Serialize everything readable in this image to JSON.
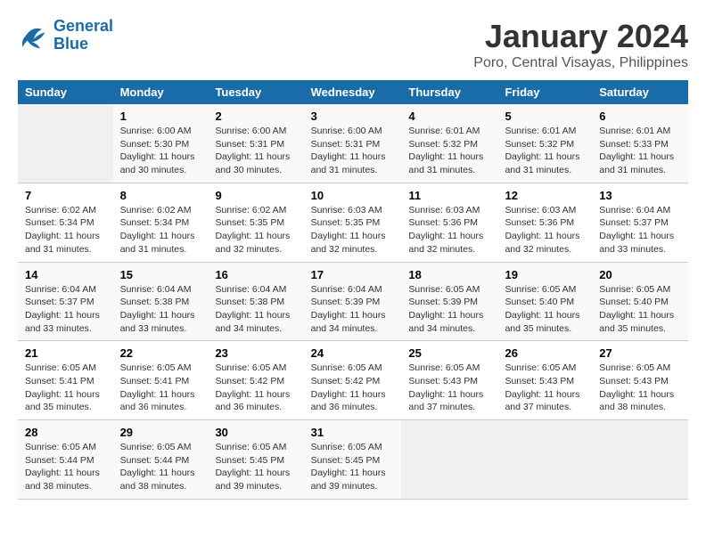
{
  "logo": {
    "line1": "General",
    "line2": "Blue"
  },
  "title": "January 2024",
  "location": "Poro, Central Visayas, Philippines",
  "weekdays": [
    "Sunday",
    "Monday",
    "Tuesday",
    "Wednesday",
    "Thursday",
    "Friday",
    "Saturday"
  ],
  "rows": [
    [
      {
        "day": "",
        "info": ""
      },
      {
        "day": "1",
        "info": "Sunrise: 6:00 AM\nSunset: 5:30 PM\nDaylight: 11 hours\nand 30 minutes."
      },
      {
        "day": "2",
        "info": "Sunrise: 6:00 AM\nSunset: 5:31 PM\nDaylight: 11 hours\nand 30 minutes."
      },
      {
        "day": "3",
        "info": "Sunrise: 6:00 AM\nSunset: 5:31 PM\nDaylight: 11 hours\nand 31 minutes."
      },
      {
        "day": "4",
        "info": "Sunrise: 6:01 AM\nSunset: 5:32 PM\nDaylight: 11 hours\nand 31 minutes."
      },
      {
        "day": "5",
        "info": "Sunrise: 6:01 AM\nSunset: 5:32 PM\nDaylight: 11 hours\nand 31 minutes."
      },
      {
        "day": "6",
        "info": "Sunrise: 6:01 AM\nSunset: 5:33 PM\nDaylight: 11 hours\nand 31 minutes."
      }
    ],
    [
      {
        "day": "7",
        "info": "Sunrise: 6:02 AM\nSunset: 5:34 PM\nDaylight: 11 hours\nand 31 minutes."
      },
      {
        "day": "8",
        "info": "Sunrise: 6:02 AM\nSunset: 5:34 PM\nDaylight: 11 hours\nand 31 minutes."
      },
      {
        "day": "9",
        "info": "Sunrise: 6:02 AM\nSunset: 5:35 PM\nDaylight: 11 hours\nand 32 minutes."
      },
      {
        "day": "10",
        "info": "Sunrise: 6:03 AM\nSunset: 5:35 PM\nDaylight: 11 hours\nand 32 minutes."
      },
      {
        "day": "11",
        "info": "Sunrise: 6:03 AM\nSunset: 5:36 PM\nDaylight: 11 hours\nand 32 minutes."
      },
      {
        "day": "12",
        "info": "Sunrise: 6:03 AM\nSunset: 5:36 PM\nDaylight: 11 hours\nand 32 minutes."
      },
      {
        "day": "13",
        "info": "Sunrise: 6:04 AM\nSunset: 5:37 PM\nDaylight: 11 hours\nand 33 minutes."
      }
    ],
    [
      {
        "day": "14",
        "info": "Sunrise: 6:04 AM\nSunset: 5:37 PM\nDaylight: 11 hours\nand 33 minutes."
      },
      {
        "day": "15",
        "info": "Sunrise: 6:04 AM\nSunset: 5:38 PM\nDaylight: 11 hours\nand 33 minutes."
      },
      {
        "day": "16",
        "info": "Sunrise: 6:04 AM\nSunset: 5:38 PM\nDaylight: 11 hours\nand 34 minutes."
      },
      {
        "day": "17",
        "info": "Sunrise: 6:04 AM\nSunset: 5:39 PM\nDaylight: 11 hours\nand 34 minutes."
      },
      {
        "day": "18",
        "info": "Sunrise: 6:05 AM\nSunset: 5:39 PM\nDaylight: 11 hours\nand 34 minutes."
      },
      {
        "day": "19",
        "info": "Sunrise: 6:05 AM\nSunset: 5:40 PM\nDaylight: 11 hours\nand 35 minutes."
      },
      {
        "day": "20",
        "info": "Sunrise: 6:05 AM\nSunset: 5:40 PM\nDaylight: 11 hours\nand 35 minutes."
      }
    ],
    [
      {
        "day": "21",
        "info": "Sunrise: 6:05 AM\nSunset: 5:41 PM\nDaylight: 11 hours\nand 35 minutes."
      },
      {
        "day": "22",
        "info": "Sunrise: 6:05 AM\nSunset: 5:41 PM\nDaylight: 11 hours\nand 36 minutes."
      },
      {
        "day": "23",
        "info": "Sunrise: 6:05 AM\nSunset: 5:42 PM\nDaylight: 11 hours\nand 36 minutes."
      },
      {
        "day": "24",
        "info": "Sunrise: 6:05 AM\nSunset: 5:42 PM\nDaylight: 11 hours\nand 36 minutes."
      },
      {
        "day": "25",
        "info": "Sunrise: 6:05 AM\nSunset: 5:43 PM\nDaylight: 11 hours\nand 37 minutes."
      },
      {
        "day": "26",
        "info": "Sunrise: 6:05 AM\nSunset: 5:43 PM\nDaylight: 11 hours\nand 37 minutes."
      },
      {
        "day": "27",
        "info": "Sunrise: 6:05 AM\nSunset: 5:43 PM\nDaylight: 11 hours\nand 38 minutes."
      }
    ],
    [
      {
        "day": "28",
        "info": "Sunrise: 6:05 AM\nSunset: 5:44 PM\nDaylight: 11 hours\nand 38 minutes."
      },
      {
        "day": "29",
        "info": "Sunrise: 6:05 AM\nSunset: 5:44 PM\nDaylight: 11 hours\nand 38 minutes."
      },
      {
        "day": "30",
        "info": "Sunrise: 6:05 AM\nSunset: 5:45 PM\nDaylight: 11 hours\nand 39 minutes."
      },
      {
        "day": "31",
        "info": "Sunrise: 6:05 AM\nSunset: 5:45 PM\nDaylight: 11 hours\nand 39 minutes."
      },
      {
        "day": "",
        "info": ""
      },
      {
        "day": "",
        "info": ""
      },
      {
        "day": "",
        "info": ""
      }
    ]
  ]
}
